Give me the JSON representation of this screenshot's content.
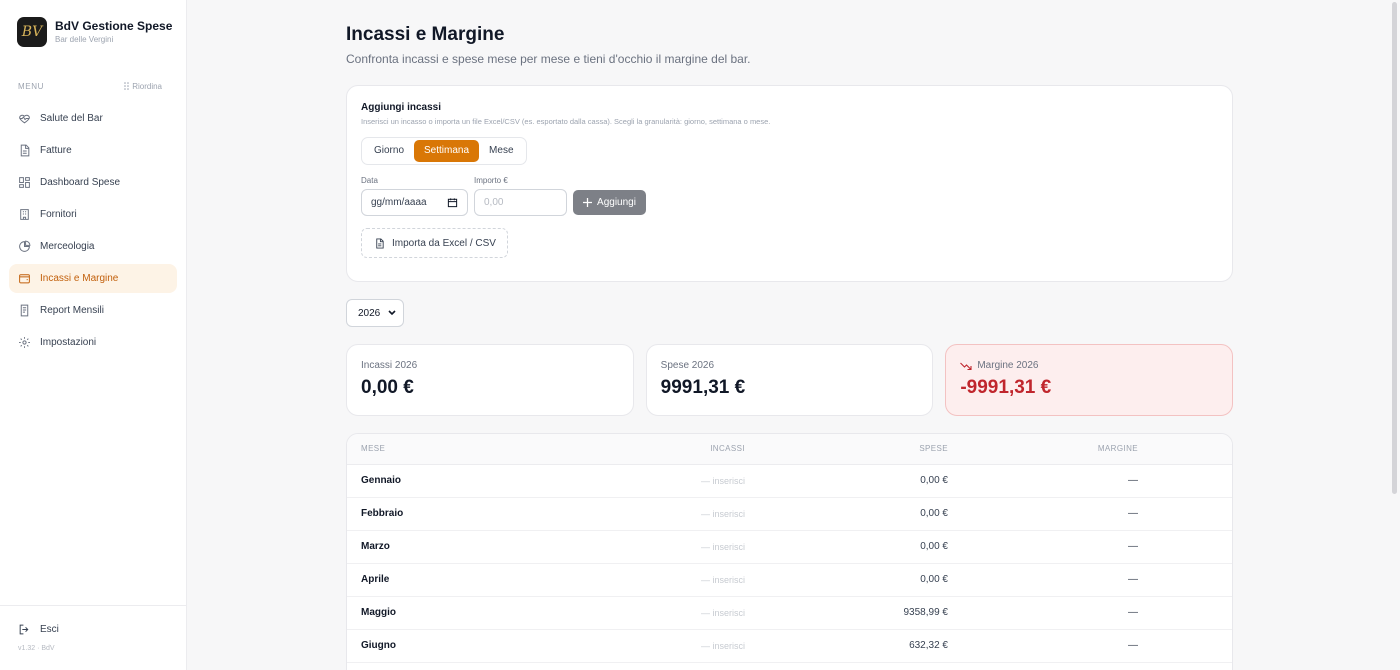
{
  "brand": {
    "title": "BdV Gestione Spese",
    "subtitle": "Bar delle Vergini",
    "logo": "BV"
  },
  "sidebar": {
    "menu_label": "MENU",
    "reorder_label": "Riordina",
    "items": [
      {
        "label": "Salute del Bar",
        "icon": "heart-pulse-icon"
      },
      {
        "label": "Fatture",
        "icon": "document-icon"
      },
      {
        "label": "Dashboard Spese",
        "icon": "dashboard-icon"
      },
      {
        "label": "Fornitori",
        "icon": "building-icon"
      },
      {
        "label": "Merceologia",
        "icon": "pie-chart-icon"
      },
      {
        "label": "Incassi e Margine",
        "icon": "wallet-icon",
        "active": true
      },
      {
        "label": "Report Mensili",
        "icon": "report-icon"
      },
      {
        "label": "Impostazioni",
        "icon": "gear-icon"
      }
    ],
    "logout_label": "Esci",
    "version": "v1.32 · BdV"
  },
  "page": {
    "title": "Incassi e Margine",
    "subtitle": "Confronta incassi e spese mese per mese e tieni d'occhio il margine del bar."
  },
  "add_income": {
    "title": "Aggiungi incassi",
    "description": "Inserisci un incasso o importa un file Excel/CSV (es. esportato dalla cassa). Scegli la granularità: giorno, settimana o mese.",
    "granularity": [
      "Giorno",
      "Settimana",
      "Mese"
    ],
    "granularity_selected": "Settimana",
    "date_label": "Data",
    "date_placeholder": "gg/mm/aaaa",
    "amount_label": "Importo €",
    "amount_placeholder": "0,00",
    "add_button": "Aggiungi",
    "import_button": "Importa da Excel / CSV"
  },
  "year_selector": {
    "value": "2026"
  },
  "stats": {
    "income": {
      "label": "Incassi 2026",
      "value": "0,00 €"
    },
    "expenses": {
      "label": "Spese 2026",
      "value": "9991,31 €"
    },
    "margin": {
      "label": "Margine 2026",
      "value": "-9991,31 €",
      "color": "#c0262d"
    }
  },
  "table": {
    "headers": {
      "month": "MESE",
      "income": "INCASSI",
      "expenses": "SPESE",
      "margin": "MARGINE"
    },
    "rows": [
      {
        "month": "Gennaio",
        "income": "— inserisci",
        "expenses": "0,00 €",
        "margin": "—"
      },
      {
        "month": "Febbraio",
        "income": "— inserisci",
        "expenses": "0,00 €",
        "margin": "—"
      },
      {
        "month": "Marzo",
        "income": "— inserisci",
        "expenses": "0,00 €",
        "margin": "—"
      },
      {
        "month": "Aprile",
        "income": "— inserisci",
        "expenses": "0,00 €",
        "margin": "—"
      },
      {
        "month": "Maggio",
        "income": "— inserisci",
        "expenses": "9358,99 €",
        "margin": "—"
      },
      {
        "month": "Giugno",
        "income": "— inserisci",
        "expenses": "632,32 €",
        "margin": "—"
      }
    ]
  },
  "colors": {
    "accent": "#d97706",
    "active_bg": "#fdf3e6",
    "negative": "#c0262d"
  }
}
